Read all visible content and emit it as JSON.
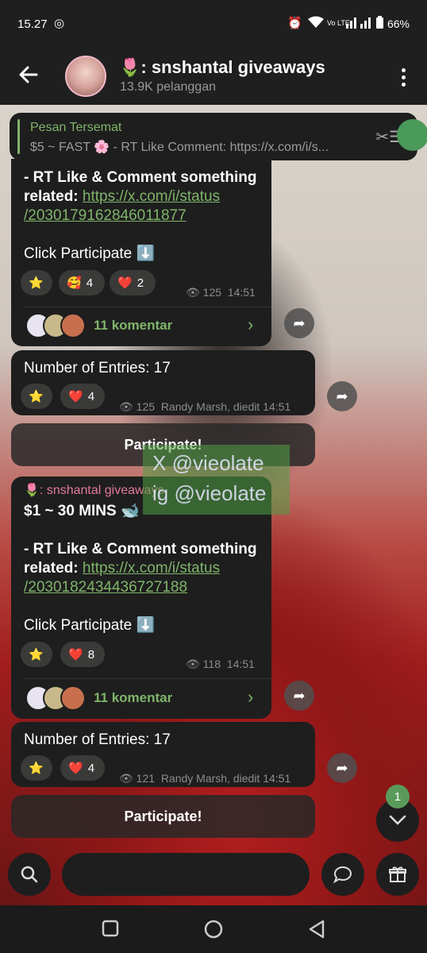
{
  "status": {
    "time": "15.27",
    "battery": "66%"
  },
  "header": {
    "title": "🌷: snshantal giveaways",
    "subscribers": "13.9K pelanggan"
  },
  "pinned": {
    "label": "Pesan Tersemat",
    "text": "$5 ~ FAST 🌸 - RT Like Comment: https://x.com/i/s..."
  },
  "msg1": {
    "line1": "- RT Like & Comment something",
    "line2_prefix": "related: ",
    "link1": "https://x.com/i/status",
    "link2": "/2030179162846011877",
    "cta": "Click Participate ⬇️",
    "reactions": [
      {
        "emoji": "⭐",
        "count": ""
      },
      {
        "emoji": "🥰",
        "count": "4"
      },
      {
        "emoji": "❤️",
        "count": "2"
      }
    ],
    "views": "125",
    "time": "14:51",
    "comments": "11 komentar"
  },
  "msg2": {
    "text": "Number of Entries: 17",
    "reactions": [
      {
        "emoji": "⭐",
        "count": ""
      },
      {
        "emoji": "❤️",
        "count": "4"
      }
    ],
    "views": "125",
    "meta": "Randy Marsh, diedit 14:51"
  },
  "participate_btn": "Participate!",
  "watermark": {
    "line1": "X @vieolate",
    "line2": "ig @vieolate"
  },
  "msg3": {
    "sender": "🌷: snshantal giveaways",
    "headline": "$1 ~ 30 MINS 🐋",
    "line1": "- RT Like & Comment something",
    "line2_prefix": "related: ",
    "link1": "https://x.com/i/status",
    "link2": "/2030182434436727188",
    "cta": "Click Participate ⬇️",
    "reactions": [
      {
        "emoji": "⭐",
        "count": ""
      },
      {
        "emoji": "❤️",
        "count": "8"
      }
    ],
    "views": "118",
    "time": "14:51",
    "comments": "11 komentar"
  },
  "msg4": {
    "text": "Number of Entries: 17",
    "reactions": [
      {
        "emoji": "⭐",
        "count": ""
      },
      {
        "emoji": "❤️",
        "count": "4"
      }
    ],
    "views": "121",
    "meta": "Randy Marsh, diedit 14:51"
  },
  "participate_btn2": "Participate!",
  "unread_badge": "1",
  "colors": {
    "accent": "#7fb56a",
    "bubble": "#1e1e1e"
  }
}
